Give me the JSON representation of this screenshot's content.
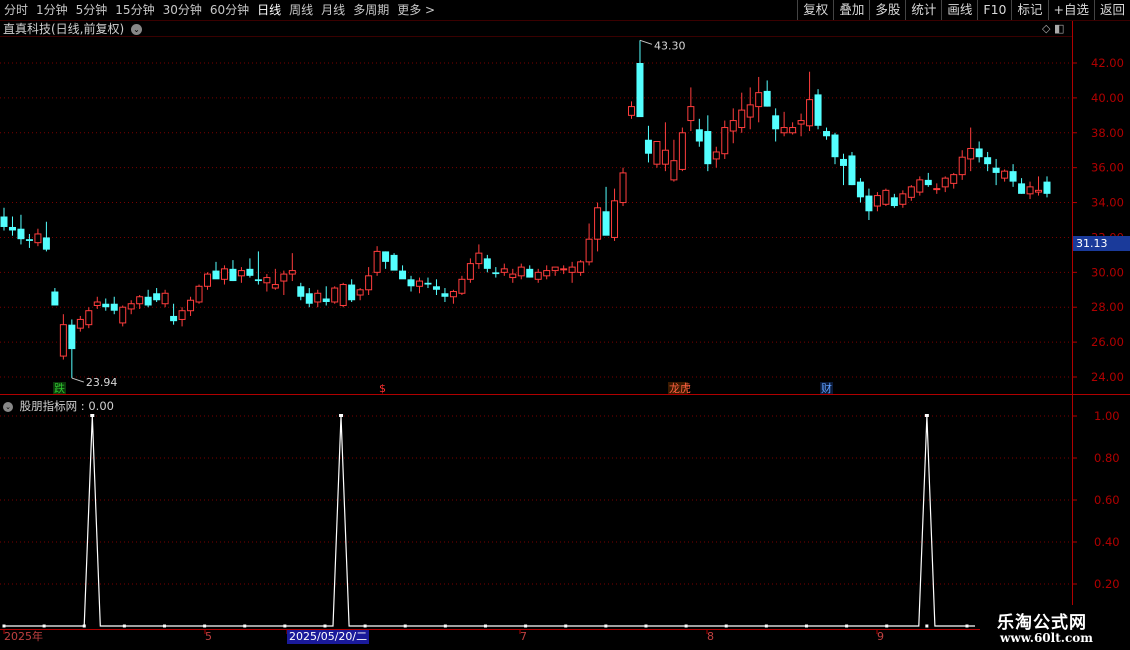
{
  "toolbar": {
    "periods": [
      "分时",
      "1分钟",
      "5分钟",
      "15分钟",
      "30分钟",
      "60分钟",
      "日线",
      "周线",
      "月线",
      "多周期",
      "更多 >"
    ],
    "active_period": "日线",
    "tools": [
      "复权",
      "叠加",
      "多股",
      "统计",
      "画线",
      "F10",
      "标记",
      "+自选",
      "返回"
    ]
  },
  "stock": {
    "title": "直真科技(日线,前复权)"
  },
  "indicator": {
    "title": "股朋指标网 : 0.00"
  },
  "price_axis": {
    "labels": [
      "42.00",
      "40.00",
      "38.00",
      "36.00",
      "34.00",
      "32.00",
      "30.00",
      "28.00",
      "26.00",
      "24.00"
    ]
  },
  "indicator_axis": {
    "labels": [
      "1.00",
      "0.80",
      "0.60",
      "0.40",
      "0.20"
    ]
  },
  "current_price": "31.13",
  "annotations": {
    "high": "43.30",
    "low": "23.94"
  },
  "event_markers": [
    {
      "label": "跌",
      "color": "#30c030",
      "bg": "#0a3a0a"
    },
    {
      "label": "$",
      "color": "#ff3030",
      "bg": "#000000"
    },
    {
      "label": "龙虎",
      "color": "#ff6040",
      "bg": "#3a1a00"
    },
    {
      "label": "财",
      "color": "#60a0ff",
      "bg": "#0a1a3a"
    }
  ],
  "date_axis": {
    "labels": [
      "2025年",
      "5",
      "7",
      "8",
      "9"
    ],
    "cursor_label": "2025/05/20/二"
  },
  "watermark": {
    "line1": "乐淘公式网",
    "line2": "www.60lt.com"
  },
  "colors": {
    "up": "#ff3d3d",
    "down": "#54ffff",
    "grid": "#7a0000",
    "axis": "#b00000",
    "indicator_line": "#ffffff"
  },
  "chart_data": [
    {
      "type": "candlestick",
      "title": "直真科技(日线,前复权)",
      "ylim": [
        23.0,
        43.6
      ],
      "y_ticks": [
        24,
        26,
        28,
        30,
        32,
        34,
        36,
        38,
        40,
        42
      ],
      "high": 43.3,
      "low": 23.94,
      "last": 31.13,
      "candles_ohlc": [
        [
          33.2,
          33.7,
          32.4,
          32.6
        ],
        [
          32.6,
          33.2,
          32.1,
          32.4
        ],
        [
          32.5,
          33.3,
          31.6,
          31.9
        ],
        [
          31.9,
          32.2,
          31.4,
          31.8
        ],
        [
          31.7,
          32.5,
          31.5,
          32.2
        ],
        [
          32.0,
          32.9,
          31.2,
          31.3
        ],
        [
          28.9,
          29.1,
          28.2,
          28.1
        ],
        [
          25.2,
          27.6,
          25.0,
          27.0
        ],
        [
          27.0,
          27.3,
          23.94,
          25.6
        ],
        [
          26.8,
          27.5,
          26.6,
          27.3
        ],
        [
          27.0,
          28.0,
          26.8,
          27.8
        ],
        [
          28.1,
          28.6,
          27.9,
          28.3
        ],
        [
          28.2,
          28.5,
          27.8,
          28.0
        ],
        [
          28.2,
          28.6,
          27.6,
          27.8
        ],
        [
          27.1,
          28.1,
          26.9,
          28.0
        ],
        [
          27.9,
          28.4,
          27.6,
          28.2
        ],
        [
          28.2,
          28.7,
          27.9,
          28.6
        ],
        [
          28.6,
          29.0,
          28.0,
          28.1
        ],
        [
          28.8,
          29.1,
          28.3,
          28.4
        ],
        [
          28.2,
          29.0,
          28.0,
          28.8
        ],
        [
          27.5,
          28.2,
          27.0,
          27.2
        ],
        [
          27.3,
          28.0,
          26.9,
          27.8
        ],
        [
          27.8,
          28.6,
          27.5,
          28.4
        ],
        [
          28.3,
          29.3,
          28.2,
          29.2
        ],
        [
          29.2,
          30.0,
          29.0,
          29.9
        ],
        [
          30.1,
          30.6,
          29.7,
          29.6
        ],
        [
          29.6,
          30.4,
          29.3,
          30.2
        ],
        [
          30.2,
          30.7,
          29.5,
          29.5
        ],
        [
          29.8,
          30.3,
          29.4,
          30.1
        ],
        [
          30.2,
          30.8,
          29.7,
          29.8
        ],
        [
          29.6,
          31.2,
          29.3,
          29.5
        ],
        [
          29.4,
          29.9,
          28.9,
          29.7
        ],
        [
          29.1,
          30.2,
          29.0,
          29.3
        ],
        [
          29.5,
          30.1,
          28.7,
          29.9
        ],
        [
          29.9,
          31.1,
          29.5,
          30.1
        ],
        [
          29.2,
          29.4,
          28.4,
          28.6
        ],
        [
          28.8,
          29.1,
          28.0,
          28.2
        ],
        [
          28.3,
          29.0,
          28.0,
          28.8
        ],
        [
          28.5,
          29.2,
          28.1,
          28.3
        ],
        [
          28.3,
          29.2,
          28.2,
          29.1
        ],
        [
          28.1,
          29.4,
          28.0,
          29.3
        ],
        [
          29.3,
          29.6,
          28.3,
          28.4
        ],
        [
          28.7,
          29.1,
          28.4,
          29.0
        ],
        [
          29.0,
          30.3,
          28.7,
          29.8
        ],
        [
          30.0,
          31.5,
          29.8,
          31.2
        ],
        [
          31.2,
          31.2,
          30.2,
          30.6
        ],
        [
          31.0,
          31.1,
          30.3,
          30.1
        ],
        [
          30.1,
          30.4,
          29.7,
          29.6
        ],
        [
          29.6,
          29.8,
          28.9,
          29.2
        ],
        [
          29.2,
          29.7,
          28.8,
          29.5
        ],
        [
          29.4,
          29.7,
          29.1,
          29.3
        ],
        [
          29.2,
          29.6,
          28.7,
          29.0
        ],
        [
          28.8,
          29.1,
          28.3,
          28.6
        ],
        [
          28.6,
          29.0,
          28.2,
          28.9
        ],
        [
          28.8,
          29.8,
          28.7,
          29.6
        ],
        [
          29.6,
          30.8,
          29.4,
          30.5
        ],
        [
          30.5,
          31.6,
          30.2,
          31.1
        ],
        [
          30.8,
          31.0,
          30.0,
          30.2
        ],
        [
          30.0,
          30.3,
          29.7,
          29.9
        ],
        [
          30.0,
          30.5,
          29.8,
          30.2
        ],
        [
          29.7,
          30.2,
          29.4,
          29.9
        ],
        [
          29.8,
          30.5,
          29.6,
          30.3
        ],
        [
          30.2,
          30.4,
          29.7,
          29.7
        ],
        [
          29.6,
          30.2,
          29.4,
          30.0
        ],
        [
          29.8,
          30.4,
          29.6,
          30.1
        ],
        [
          30.1,
          30.3,
          29.8,
          30.3
        ],
        [
          30.2,
          30.4,
          29.9,
          30.2
        ],
        [
          30.0,
          30.6,
          29.4,
          30.3
        ],
        [
          30.0,
          30.7,
          29.8,
          30.6
        ],
        [
          30.6,
          32.8,
          30.4,
          31.9
        ],
        [
          31.9,
          34.0,
          31.2,
          33.7
        ],
        [
          33.5,
          34.9,
          33.2,
          32.1
        ],
        [
          32.0,
          34.8,
          31.8,
          34.1
        ],
        [
          34.0,
          36.0,
          33.8,
          35.7
        ],
        [
          39.0,
          39.8,
          38.8,
          39.5
        ],
        [
          42.0,
          43.3,
          41.4,
          38.9
        ],
        [
          37.6,
          38.4,
          36.3,
          36.8
        ],
        [
          36.2,
          37.5,
          36.0,
          37.5
        ],
        [
          36.2,
          38.6,
          35.8,
          37.0
        ],
        [
          35.3,
          37.6,
          35.2,
          36.4
        ],
        [
          35.9,
          38.3,
          35.8,
          38.0
        ],
        [
          38.7,
          40.6,
          38.1,
          39.5
        ],
        [
          38.2,
          38.8,
          37.2,
          37.5
        ],
        [
          38.1,
          39.0,
          35.8,
          36.2
        ],
        [
          36.5,
          37.2,
          36.0,
          36.9
        ],
        [
          36.8,
          38.7,
          36.5,
          38.3
        ],
        [
          38.1,
          39.4,
          37.4,
          38.7
        ],
        [
          38.3,
          40.3,
          38.0,
          39.3
        ],
        [
          38.9,
          40.6,
          38.2,
          39.6
        ],
        [
          39.5,
          41.2,
          38.6,
          40.3
        ],
        [
          40.4,
          41.0,
          39.5,
          39.5
        ],
        [
          39.0,
          39.4,
          37.5,
          38.2
        ],
        [
          38.0,
          39.2,
          37.8,
          38.3
        ],
        [
          38.0,
          38.6,
          37.9,
          38.3
        ],
        [
          38.5,
          39.1,
          37.8,
          38.7
        ],
        [
          38.4,
          41.5,
          38.1,
          39.9
        ],
        [
          40.2,
          40.5,
          38.2,
          38.4
        ],
        [
          38.1,
          38.3,
          37.6,
          37.8
        ],
        [
          37.9,
          38.0,
          36.2,
          36.6
        ],
        [
          36.5,
          36.8,
          35.0,
          36.1
        ],
        [
          36.7,
          36.9,
          35.0,
          35.0
        ],
        [
          35.2,
          35.4,
          34.0,
          34.3
        ],
        [
          34.4,
          34.8,
          33.0,
          33.5
        ],
        [
          33.8,
          34.6,
          33.5,
          34.4
        ],
        [
          33.9,
          34.8,
          33.8,
          34.7
        ],
        [
          34.3,
          34.5,
          33.7,
          33.8
        ],
        [
          33.9,
          34.7,
          33.7,
          34.5
        ],
        [
          34.3,
          35.0,
          34.1,
          34.9
        ],
        [
          34.6,
          35.5,
          34.4,
          35.3
        ],
        [
          35.3,
          35.7,
          34.9,
          35.0
        ],
        [
          34.8,
          35.1,
          34.5,
          34.8
        ],
        [
          34.9,
          35.5,
          34.6,
          35.4
        ],
        [
          35.1,
          35.7,
          34.8,
          35.6
        ],
        [
          35.6,
          37.0,
          35.3,
          36.6
        ],
        [
          36.5,
          38.3,
          35.8,
          37.1
        ],
        [
          37.1,
          37.5,
          36.3,
          36.6
        ],
        [
          36.6,
          36.9,
          35.8,
          36.2
        ],
        [
          36.0,
          36.5,
          35.0,
          35.7
        ],
        [
          35.4,
          35.9,
          35.2,
          35.8
        ],
        [
          35.8,
          36.2,
          34.9,
          35.2
        ],
        [
          35.1,
          35.4,
          34.5,
          34.5
        ],
        [
          34.5,
          35.2,
          34.2,
          34.9
        ],
        [
          34.6,
          35.5,
          34.4,
          34.7
        ],
        [
          35.2,
          35.5,
          34.3,
          34.5
        ]
      ]
    },
    {
      "type": "line",
      "title": "股朋指标网",
      "ylim": [
        0,
        1.1
      ],
      "y_ticks": [
        0.2,
        0.4,
        0.6,
        0.8,
        1.0
      ],
      "spikes": [
        {
          "date_index": 11,
          "value": 1.0
        },
        {
          "date_index": 42,
          "value": 1.0
        },
        {
          "date_index": 115,
          "value": 1.0
        }
      ],
      "baseline": 0.0,
      "n_points": 122
    }
  ]
}
